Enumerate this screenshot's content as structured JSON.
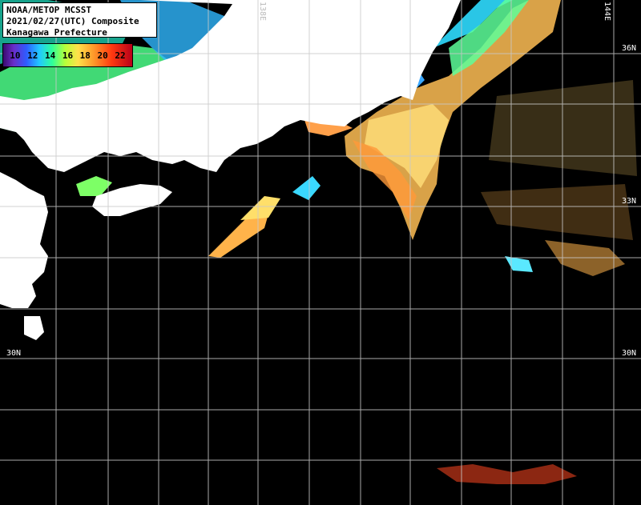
{
  "header": {
    "line1": "NOAA/METOP MCSST",
    "line2": "2021/02/27(UTC) Composite",
    "line3": "Kanagawa Prefecture"
  },
  "scale": {
    "labels": [
      "10",
      "12",
      "14",
      "16",
      "18",
      "20",
      "22"
    ]
  },
  "grid_labels": {
    "lat_36": "36N",
    "lat_33": "33N",
    "lat_30_left": "30N",
    "lat_30_right": "30N",
    "lon_144": "144E",
    "lon_138": "138E"
  },
  "colors": {
    "land": "#ffffff",
    "ocean_nodata": "#000000",
    "grid": "#c8c8c8"
  }
}
